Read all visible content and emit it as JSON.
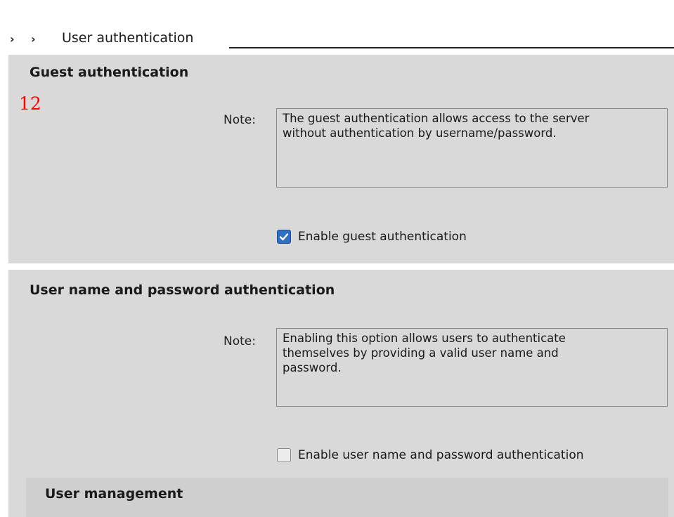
{
  "breadcrumb": {
    "chevrons": [
      "›",
      "›"
    ],
    "label": "User authentication"
  },
  "guest_section": {
    "title": "Guest authentication",
    "marker": "12",
    "note_label": "Note:",
    "note_lines": [
      "The guest authentication allows access to the server",
      "without authentication by username/password."
    ],
    "checkbox_label": "Enable guest authentication",
    "checked": true
  },
  "userpass_section": {
    "title": "User name and password authentication",
    "note_label": "Note:",
    "note_lines": [
      "Enabling this option allows users to authenticate",
      "themselves by providing a valid user name and",
      "password."
    ],
    "checkbox_label": "Enable user name and password authentication",
    "checked": false
  },
  "user_management": {
    "title": "User management"
  },
  "colors": {
    "panel_bg": "#d9d9d9",
    "check_blue": "#2f6fc3",
    "marker_red": "#ff0000"
  },
  "icons": {
    "chevron": "chevron-right-icon",
    "check": "checkmark-icon"
  }
}
